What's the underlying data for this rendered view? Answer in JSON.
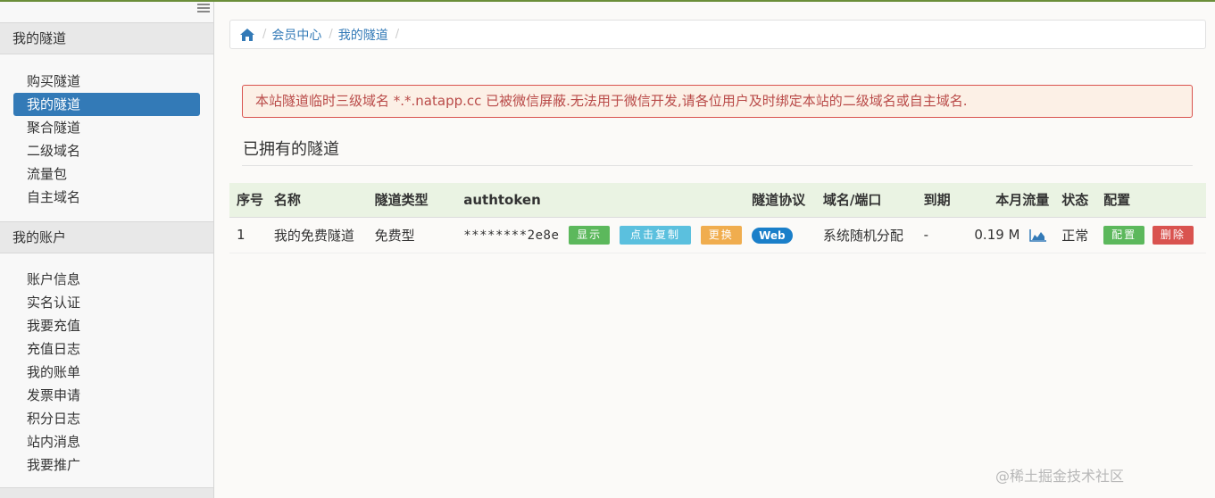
{
  "sidebar": {
    "sections": [
      {
        "title": "我的隧道",
        "items": [
          {
            "label": "购买隧道"
          },
          {
            "label": "我的隧道"
          },
          {
            "label": "聚合隧道"
          },
          {
            "label": "二级域名"
          },
          {
            "label": "流量包"
          },
          {
            "label": "自主域名"
          }
        ]
      },
      {
        "title": "我的账户",
        "items": [
          {
            "label": "账户信息"
          },
          {
            "label": "实名认证"
          },
          {
            "label": "我要充值"
          },
          {
            "label": "充值日志"
          },
          {
            "label": "我的账单"
          },
          {
            "label": "发票申请"
          },
          {
            "label": "积分日志"
          },
          {
            "label": "站内消息"
          },
          {
            "label": "我要推广"
          }
        ]
      }
    ],
    "active_item": "我的隧道"
  },
  "breadcrumb": {
    "items": [
      "会员中心",
      "我的隧道"
    ]
  },
  "alert": {
    "text": "本站隧道临时三级域名 *.*.natapp.cc 已被微信屏蔽.无法用于微信开发,请各位用户及时绑定本站的二级域名或自主域名."
  },
  "tunnels": {
    "title": "已拥有的隧道",
    "columns": [
      "序号",
      "名称",
      "隧道类型",
      "authtoken",
      "隧道协议",
      "域名/端口",
      "到期",
      "本月流量",
      "状态",
      "配置"
    ],
    "rows": [
      {
        "no": "1",
        "name": "我的免费隧道",
        "type": "免费型",
        "authtoken": "********2e8e",
        "show_btn": "显示",
        "copy_btn": "点击复制",
        "change_btn": "更换",
        "protocol": "Web",
        "domain": "系统随机分配",
        "expire": "-",
        "traffic": "0.19 M",
        "status": "正常",
        "config_btn": "配置",
        "delete_btn": "删除"
      }
    ]
  },
  "watermark": "@稀土掘金技术社区",
  "colors": {
    "primary": "#337ab7",
    "success": "#5cb85c",
    "info": "#5bc0de",
    "warning": "#f0ad4e",
    "danger": "#d9534f",
    "table_header_bg": "#eaf3e3"
  },
  "icons": [
    "menu-collapse-icon",
    "home-icon",
    "area-chart-icon"
  ]
}
